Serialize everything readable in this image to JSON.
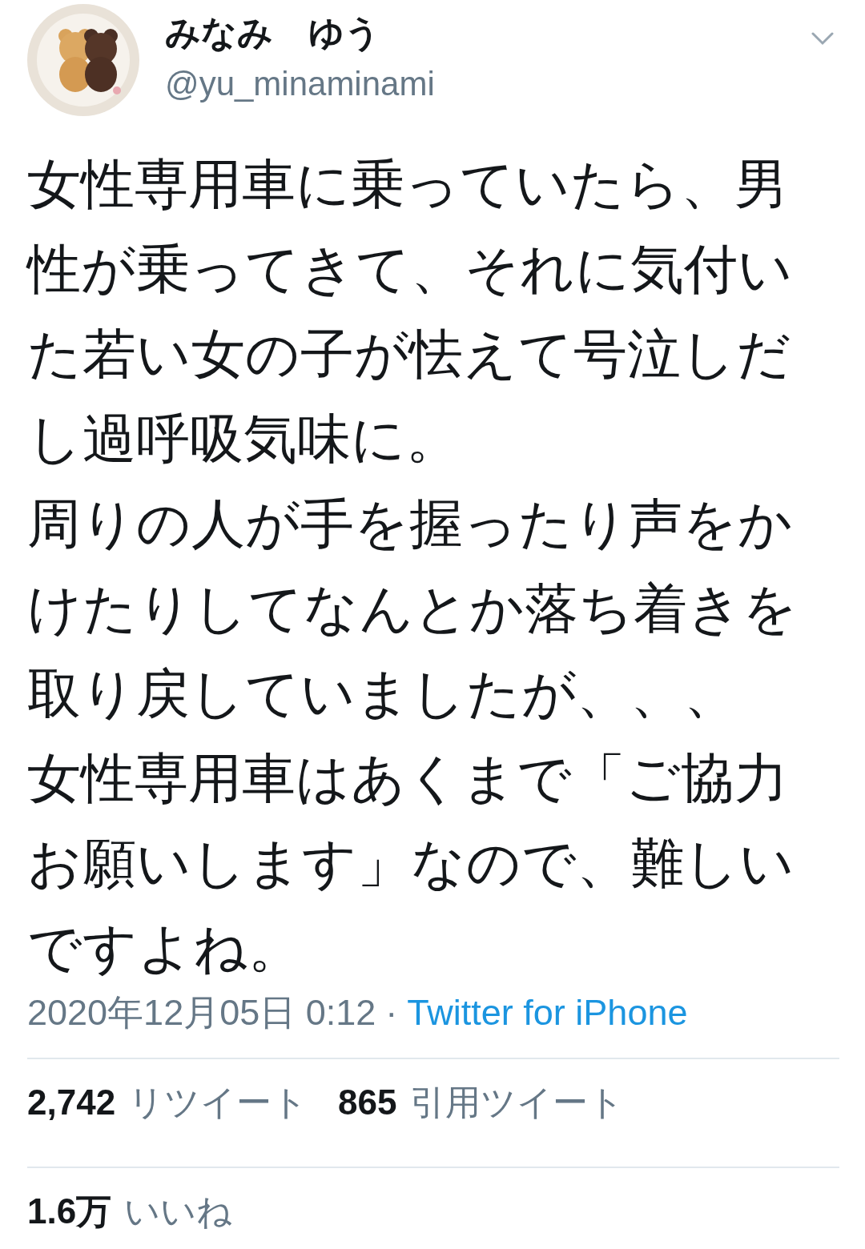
{
  "author": {
    "name": "みなみ　ゆう",
    "handle": "@yu_minaminami"
  },
  "tweet": {
    "paragraphs": [
      "女性専用車に乗っていたら、男性が乗ってきて、それに気付いた若い女の子が怯えて号泣しだし過呼吸気味に。",
      "周りの人が手を握ったり声をかけたりしてなんとか落ち着きを取り戻していましたが、、、",
      "女性専用車はあくまで「ご協力お願いします」なので、難しいですよね。"
    ],
    "timestamp": "2020年12月05日 0:12",
    "separator": "·",
    "source": "Twitter for iPhone"
  },
  "stats": [
    {
      "count": "2,742",
      "label": "リツイート"
    },
    {
      "count": "865",
      "label": "引用ツイート"
    }
  ],
  "likes": {
    "count": "1.6万",
    "label": "いいね"
  }
}
